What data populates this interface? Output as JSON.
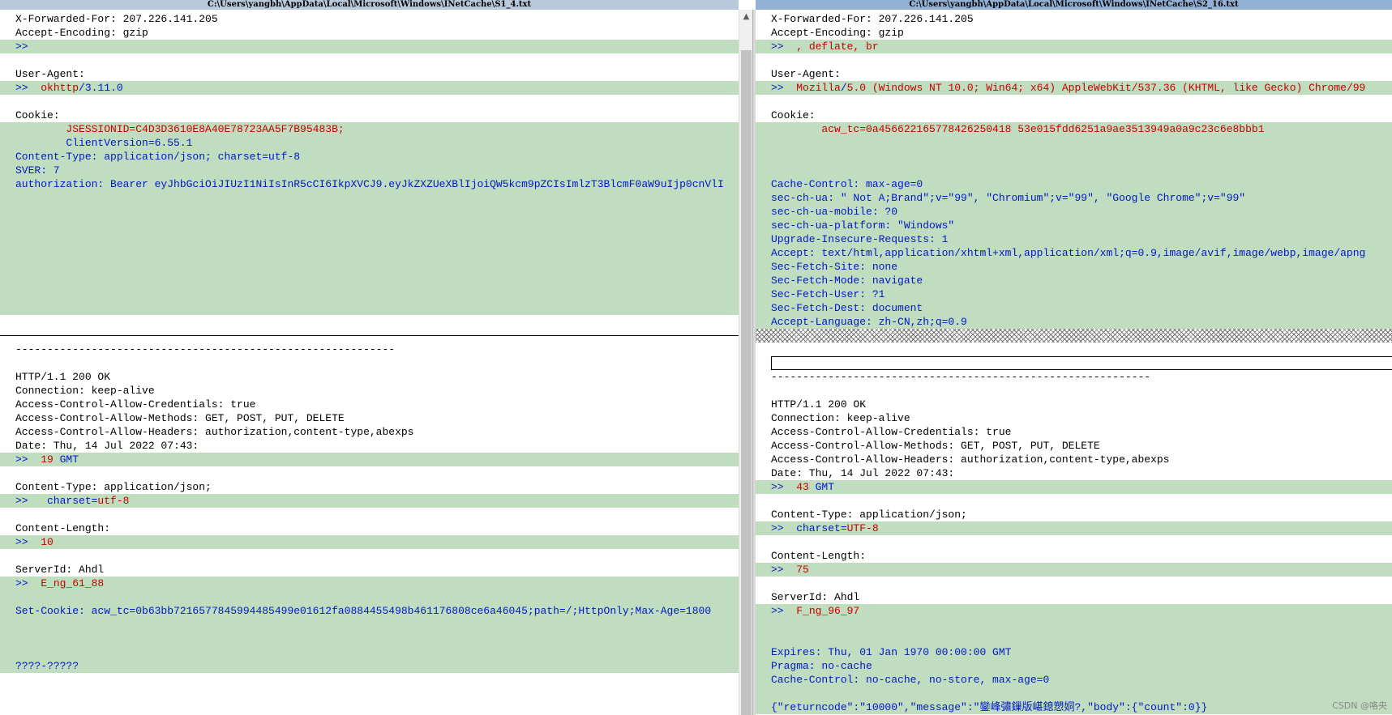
{
  "left": {
    "title": "C:\\Users\\yangbh\\AppData\\Local\\Microsoft\\Windows\\INetCache\\S1_4.txt",
    "lines": [
      {
        "bg": "",
        "spans": [
          {
            "t": "X-Forwarded-For: 207.226.141.205",
            "c": "blk"
          }
        ]
      },
      {
        "bg": "",
        "spans": [
          {
            "t": "Accept-Encoding: gzip",
            "c": "blk"
          }
        ]
      },
      {
        "bg": "diff",
        "spans": [
          {
            "t": ">>",
            "c": "blu"
          }
        ]
      },
      {
        "bg": "",
        "spans": []
      },
      {
        "bg": "",
        "spans": [
          {
            "t": "User-Agent:",
            "c": "blk"
          }
        ]
      },
      {
        "bg": "diff",
        "spans": [
          {
            "t": ">>  ",
            "c": "blu"
          },
          {
            "t": "okhttp",
            "c": "red"
          },
          {
            "t": "/",
            "c": "blu"
          },
          {
            "t": "3.11.0",
            "c": "blu"
          }
        ]
      },
      {
        "bg": "",
        "spans": []
      },
      {
        "bg": "",
        "spans": [
          {
            "t": "Cookie:",
            "c": "blk"
          }
        ]
      },
      {
        "bg": "diff",
        "spans": [
          {
            "t": "        JSESSIONID=C4D3D3610E8A40E78723AA5F7B95483B;",
            "c": "red"
          }
        ]
      },
      {
        "bg": "diff",
        "spans": [
          {
            "t": "        ClientVersion=6.55.1",
            "c": "blu"
          }
        ]
      },
      {
        "bg": "diff",
        "spans": [
          {
            "t": "Content-Type: application/json; charset=utf-8",
            "c": "blu"
          }
        ]
      },
      {
        "bg": "diff",
        "spans": [
          {
            "t": "SVER: 7",
            "c": "blu"
          }
        ]
      },
      {
        "bg": "diff",
        "spans": [
          {
            "t": "authorization: Bearer eyJhbGciOiJIUzI1NiIsInR5cCI6IkpXVCJ9.eyJkZXZUeXBlIjoiQW5kcm9pZCIsImlzT3BlcmF0aW9uIjp0cnVlI",
            "c": "blu"
          }
        ]
      },
      {
        "bg": "diff",
        "spans": []
      },
      {
        "bg": "diff",
        "spans": []
      },
      {
        "bg": "diff",
        "spans": []
      },
      {
        "bg": "diff",
        "spans": []
      },
      {
        "bg": "diff",
        "spans": []
      },
      {
        "bg": "diff",
        "spans": []
      },
      {
        "bg": "diff",
        "spans": []
      },
      {
        "bg": "diff",
        "spans": []
      },
      {
        "bg": "diff",
        "spans": []
      },
      {
        "bg": "",
        "spans": []
      },
      {
        "bg": "sep",
        "spans": []
      },
      {
        "bg": "",
        "spans": [
          {
            "t": "------------------------------------------------------------",
            "c": "blk"
          }
        ]
      },
      {
        "bg": "",
        "spans": []
      },
      {
        "bg": "",
        "spans": [
          {
            "t": "HTTP/1.1 200 OK",
            "c": "blk"
          }
        ]
      },
      {
        "bg": "",
        "spans": [
          {
            "t": "Connection: keep-alive",
            "c": "blk"
          }
        ]
      },
      {
        "bg": "",
        "spans": [
          {
            "t": "Access-Control-Allow-Credentials: true",
            "c": "blk"
          }
        ]
      },
      {
        "bg": "",
        "spans": [
          {
            "t": "Access-Control-Allow-Methods: GET, POST, PUT, DELETE",
            "c": "blk"
          }
        ]
      },
      {
        "bg": "",
        "spans": [
          {
            "t": "Access-Control-Allow-Headers: authorization,content-type,abexps",
            "c": "blk"
          }
        ]
      },
      {
        "bg": "",
        "spans": [
          {
            "t": "Date: Thu, 14 Jul 2022 07:43:",
            "c": "blk"
          }
        ]
      },
      {
        "bg": "diff",
        "spans": [
          {
            "t": ">>  ",
            "c": "blu"
          },
          {
            "t": "19",
            "c": "red"
          },
          {
            "t": " GMT",
            "c": "blu"
          }
        ]
      },
      {
        "bg": "",
        "spans": []
      },
      {
        "bg": "",
        "spans": [
          {
            "t": "Content-Type: application/json;",
            "c": "blk"
          }
        ]
      },
      {
        "bg": "diff",
        "spans": [
          {
            "t": ">>   charset=",
            "c": "blu"
          },
          {
            "t": "utf-8",
            "c": "red"
          }
        ]
      },
      {
        "bg": "",
        "spans": []
      },
      {
        "bg": "",
        "spans": [
          {
            "t": "Content-Length:",
            "c": "blk"
          }
        ]
      },
      {
        "bg": "diff",
        "spans": [
          {
            "t": ">>  ",
            "c": "blu"
          },
          {
            "t": "10",
            "c": "red"
          }
        ]
      },
      {
        "bg": "",
        "spans": []
      },
      {
        "bg": "",
        "spans": [
          {
            "t": "ServerId: Ahdl",
            "c": "blk"
          }
        ]
      },
      {
        "bg": "diff",
        "spans": [
          {
            "t": ">>  ",
            "c": "blu"
          },
          {
            "t": "E_ng_61_88",
            "c": "red"
          }
        ]
      },
      {
        "bg": "diff",
        "spans": []
      },
      {
        "bg": "diff",
        "spans": [
          {
            "t": "Set-Cookie: acw_tc=0b63bb7216577845994485499e01612fa0884455498b461176808ce6a46045;path=/;HttpOnly;Max-Age=1800",
            "c": "blu"
          }
        ]
      },
      {
        "bg": "diff",
        "spans": []
      },
      {
        "bg": "diff",
        "spans": []
      },
      {
        "bg": "diff",
        "spans": []
      },
      {
        "bg": "diff",
        "spans": [
          {
            "t": "????-?????",
            "c": "blu"
          }
        ]
      }
    ]
  },
  "right": {
    "title": "C:\\Users\\yangbh\\AppData\\Local\\Microsoft\\Windows\\INetCache\\S2_16.txt",
    "lines": [
      {
        "bg": "",
        "spans": [
          {
            "t": "X-Forwarded-For: 207.226.141.205",
            "c": "blk"
          }
        ]
      },
      {
        "bg": "",
        "spans": [
          {
            "t": "Accept-Encoding: gzip",
            "c": "blk"
          }
        ]
      },
      {
        "bg": "diff",
        "spans": [
          {
            "t": ">>  ",
            "c": "blu"
          },
          {
            "t": ", deflate, br",
            "c": "red"
          }
        ]
      },
      {
        "bg": "",
        "spans": []
      },
      {
        "bg": "",
        "spans": [
          {
            "t": "User-Agent:",
            "c": "blk"
          }
        ]
      },
      {
        "bg": "diff",
        "spans": [
          {
            "t": ">>  ",
            "c": "blu"
          },
          {
            "t": "Mozilla",
            "c": "red"
          },
          {
            "t": "/",
            "c": "blu"
          },
          {
            "t": "5.0 (Windows NT 10.0; Win64; x64) AppleWebKit/537.36 (KHTML, like Gecko) Chrome/99",
            "c": "red"
          }
        ]
      },
      {
        "bg": "",
        "spans": []
      },
      {
        "bg": "",
        "spans": [
          {
            "t": "Cookie:",
            "c": "blk"
          }
        ]
      },
      {
        "bg": "diff",
        "spans": [
          {
            "t": "        acw_tc=0a456622165778426250418 53e015fdd6251a9ae3513949a0a9c23c6e8bbb1",
            "c": "red"
          }
        ]
      },
      {
        "bg": "diff",
        "spans": []
      },
      {
        "bg": "diff",
        "spans": []
      },
      {
        "bg": "diff",
        "spans": []
      },
      {
        "bg": "diff",
        "spans": [
          {
            "t": "Cache-Control: max-age=0",
            "c": "blu"
          }
        ]
      },
      {
        "bg": "diff",
        "spans": [
          {
            "t": "sec-ch-ua: \" Not A;Brand\";v=\"99\", \"Chromium\";v=\"99\", \"Google Chrome\";v=\"99\"",
            "c": "blu"
          }
        ]
      },
      {
        "bg": "diff",
        "spans": [
          {
            "t": "sec-ch-ua-mobile: ?0",
            "c": "blu"
          }
        ]
      },
      {
        "bg": "diff",
        "spans": [
          {
            "t": "sec-ch-ua-platform: \"Windows\"",
            "c": "blu"
          }
        ]
      },
      {
        "bg": "diff",
        "spans": [
          {
            "t": "Upgrade-Insecure-Requests: 1",
            "c": "blu"
          }
        ]
      },
      {
        "bg": "diff",
        "spans": [
          {
            "t": "Accept: text/html,application/xhtml+xml,application/xml;q=0.9,image/avif,image/webp,image/apng",
            "c": "blu"
          }
        ]
      },
      {
        "bg": "diff",
        "spans": [
          {
            "t": "Sec-Fetch-Site: none",
            "c": "blu"
          }
        ]
      },
      {
        "bg": "diff",
        "spans": [
          {
            "t": "Sec-Fetch-Mode: navigate",
            "c": "blu"
          }
        ]
      },
      {
        "bg": "diff",
        "spans": [
          {
            "t": "Sec-Fetch-User: ?1",
            "c": "blu"
          }
        ]
      },
      {
        "bg": "diff",
        "spans": [
          {
            "t": "Sec-Fetch-Dest: document",
            "c": "blu"
          }
        ]
      },
      {
        "bg": "diff",
        "spans": [
          {
            "t": "Accept-Language: zh-CN,zh;q=0.9",
            "c": "blu"
          }
        ]
      },
      {
        "bg": "hatched",
        "spans": []
      },
      {
        "bg": "",
        "spans": []
      },
      {
        "bg": "sep",
        "spans": []
      },
      {
        "bg": "",
        "spans": [
          {
            "t": "------------------------------------------------------------",
            "c": "blk"
          }
        ]
      },
      {
        "bg": "",
        "spans": []
      },
      {
        "bg": "",
        "spans": [
          {
            "t": "HTTP/1.1 200 OK",
            "c": "blk"
          }
        ]
      },
      {
        "bg": "",
        "spans": [
          {
            "t": "Connection: keep-alive",
            "c": "blk"
          }
        ]
      },
      {
        "bg": "",
        "spans": [
          {
            "t": "Access-Control-Allow-Credentials: true",
            "c": "blk"
          }
        ]
      },
      {
        "bg": "",
        "spans": [
          {
            "t": "Access-Control-Allow-Methods: GET, POST, PUT, DELETE",
            "c": "blk"
          }
        ]
      },
      {
        "bg": "",
        "spans": [
          {
            "t": "Access-Control-Allow-Headers: authorization,content-type,abexps",
            "c": "blk"
          }
        ]
      },
      {
        "bg": "",
        "spans": [
          {
            "t": "Date: Thu, 14 Jul 2022 07:43:",
            "c": "blk"
          }
        ]
      },
      {
        "bg": "diff",
        "spans": [
          {
            "t": ">>  ",
            "c": "blu"
          },
          {
            "t": "43",
            "c": "red"
          },
          {
            "t": " GMT",
            "c": "blu"
          }
        ]
      },
      {
        "bg": "",
        "spans": []
      },
      {
        "bg": "",
        "spans": [
          {
            "t": "Content-Type: application/json;",
            "c": "blk"
          }
        ]
      },
      {
        "bg": "diff",
        "spans": [
          {
            "t": ">>  charset=",
            "c": "blu"
          },
          {
            "t": "UTF-8",
            "c": "red"
          }
        ]
      },
      {
        "bg": "",
        "spans": []
      },
      {
        "bg": "",
        "spans": [
          {
            "t": "Content-Length:",
            "c": "blk"
          }
        ]
      },
      {
        "bg": "diff",
        "spans": [
          {
            "t": ">>  ",
            "c": "blu"
          },
          {
            "t": "75",
            "c": "red"
          }
        ]
      },
      {
        "bg": "",
        "spans": []
      },
      {
        "bg": "",
        "spans": [
          {
            "t": "ServerId: Ahdl",
            "c": "blk"
          }
        ]
      },
      {
        "bg": "diff",
        "spans": [
          {
            "t": ">>  ",
            "c": "blu"
          },
          {
            "t": "F_ng_96_97",
            "c": "red"
          }
        ]
      },
      {
        "bg": "diff",
        "spans": []
      },
      {
        "bg": "diff",
        "spans": []
      },
      {
        "bg": "diff",
        "spans": [
          {
            "t": "Expires: Thu, 01 Jan 1970 00:00:00 GMT",
            "c": "blu"
          }
        ]
      },
      {
        "bg": "diff",
        "spans": [
          {
            "t": "Pragma: no-cache",
            "c": "blu"
          }
        ]
      },
      {
        "bg": "diff",
        "spans": [
          {
            "t": "Cache-Control: no-cache, no-store, max-age=0",
            "c": "blu"
          }
        ]
      },
      {
        "bg": "diff",
        "spans": []
      },
      {
        "bg": "diff",
        "spans": [
          {
            "t": "{\"returncode\":\"10000\",\"message\":\"",
            "c": "blu"
          },
          {
            "t": "鑾峰彇鏁版嵁鎴愬姛",
            "c": "blu"
          },
          {
            "t": "?,\"body\":{\"count\":0}}",
            "c": "blu"
          }
        ]
      }
    ]
  },
  "gutter_markers": [
    {
      "label": "▯x\nx▯",
      "row": 2
    },
    {
      "label": "▯x\nx▯",
      "row": 5
    },
    {
      "label": "▯x\nx▯",
      "row": 8
    },
    {
      "label": "▯x\nx▯",
      "row": 33
    },
    {
      "label": "▯x\nx▯",
      "row": 36
    },
    {
      "label": "▯x\nx▯",
      "row": 39
    },
    {
      "label": "▯x\nx▯",
      "row": 42
    }
  ],
  "scrollbar": {
    "up_icon": "▲"
  },
  "watermark": "CSDN @咯央",
  "colors": {
    "diff_bg": "#c0ddc0",
    "changed_text": "#c80000",
    "moved_text": "#0018c8"
  }
}
